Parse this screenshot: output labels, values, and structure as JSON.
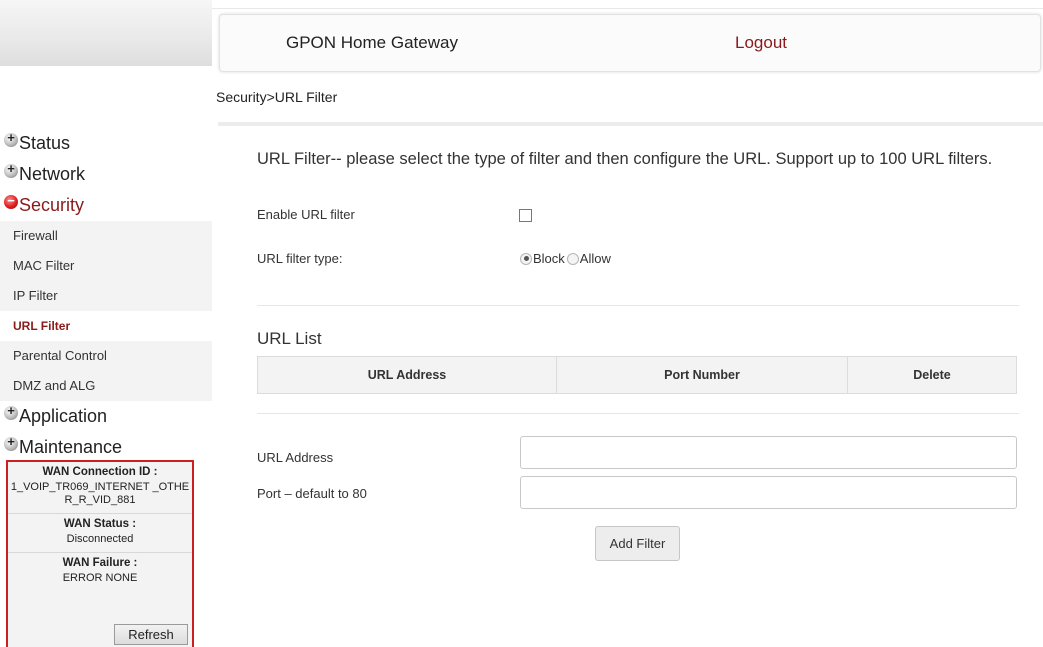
{
  "header": {
    "title": "GPON Home Gateway",
    "logout": "Logout"
  },
  "breadcrumb": "Security>URL Filter",
  "sidebar": {
    "status": "Status",
    "network": "Network",
    "security": "Security",
    "security_items": [
      "Firewall",
      "MAC Filter",
      "IP Filter",
      "URL Filter",
      "Parental Control",
      "DMZ and ALG"
    ],
    "application": "Application",
    "maintenance": "Maintenance"
  },
  "wan": {
    "conn_label": "WAN Connection ID :",
    "conn_value": "1_VOIP_TR069_INTERNET _OTHER_R_VID_881",
    "status_label": "WAN Status :",
    "status_value": "Disconnected",
    "failure_label": "WAN Failure :",
    "failure_value": "ERROR NONE",
    "refresh": "Refresh"
  },
  "main": {
    "intro": "URL Filter-- please select the type of filter and then configure the URL. Support up to 100 URL filters.",
    "enable_label": "Enable URL filter",
    "enable_checked": false,
    "type_label": "URL filter type:",
    "type_options": [
      "Block",
      "Allow"
    ],
    "type_selected": "Block",
    "list_title": "URL List",
    "columns": [
      "URL Address",
      "Port Number",
      "Delete"
    ],
    "url_label": "URL Address",
    "url_value": "",
    "port_label": "Port – default to 80",
    "port_value": "",
    "add_button": "Add Filter"
  },
  "colors": {
    "accent": "#8b1a1a",
    "wan_border": "#cc1f1f"
  }
}
